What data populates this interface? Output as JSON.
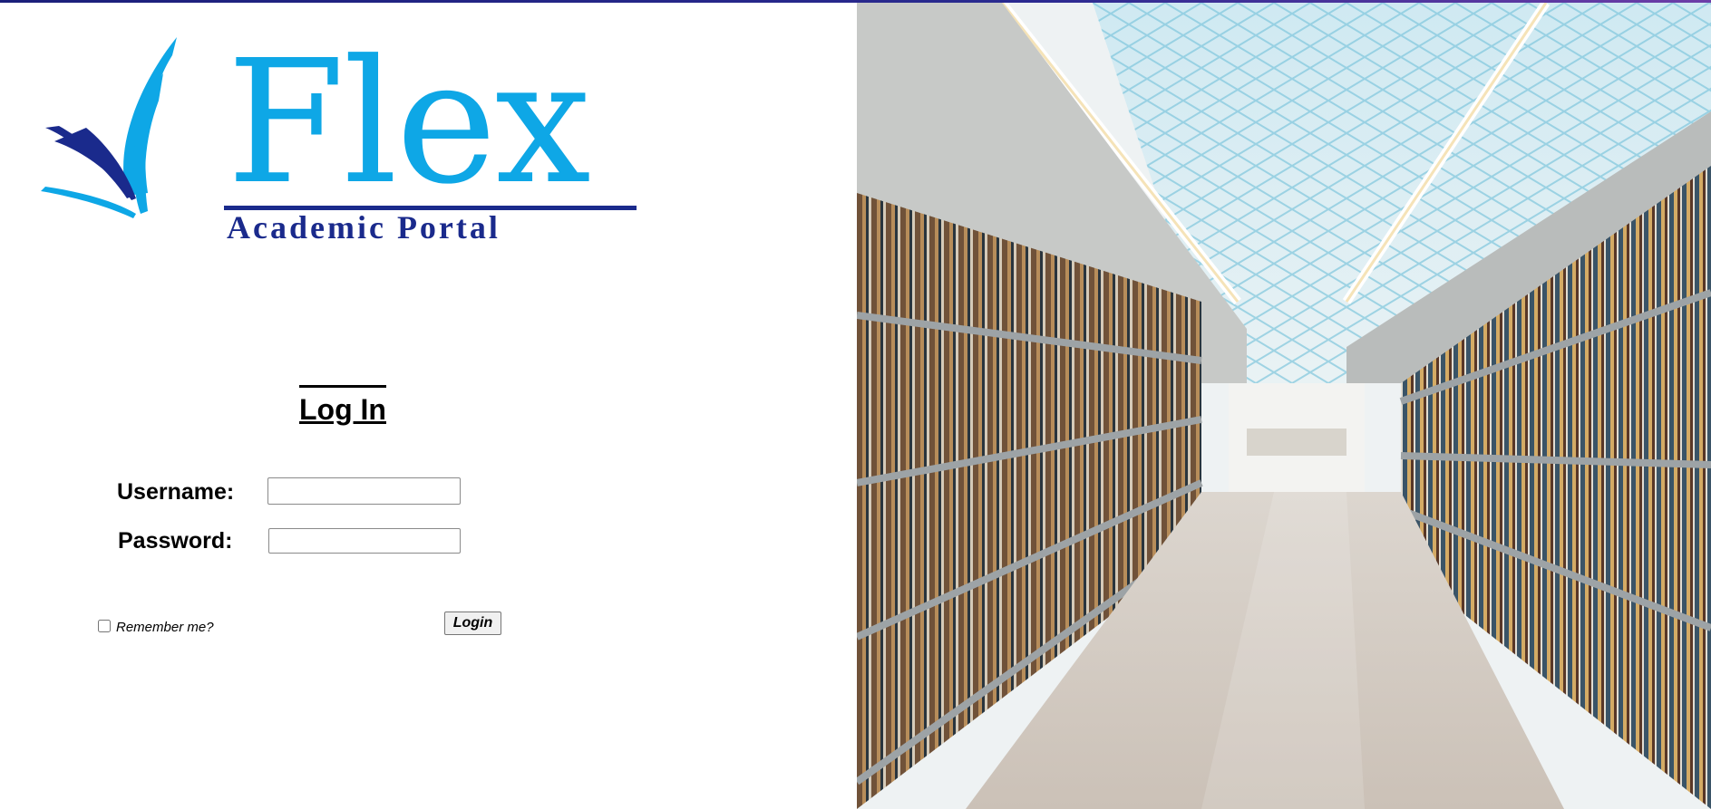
{
  "logo": {
    "title": "Flex",
    "subtitle": "Academic Portal",
    "icon": "flex-swoosh-logo"
  },
  "login": {
    "heading": "Log In",
    "username_label": "Username:",
    "username_value": "",
    "password_label": "Password:",
    "password_value": "",
    "remember_label": "Remember me?",
    "remember_checked": false,
    "submit_label": "Login"
  },
  "hero": {
    "icon": "library-bookshelves-photo"
  },
  "colors": {
    "logo_primary": "#0ea7e6",
    "logo_secondary": "#1a2a8c",
    "top_border": "#1b1f7a"
  }
}
